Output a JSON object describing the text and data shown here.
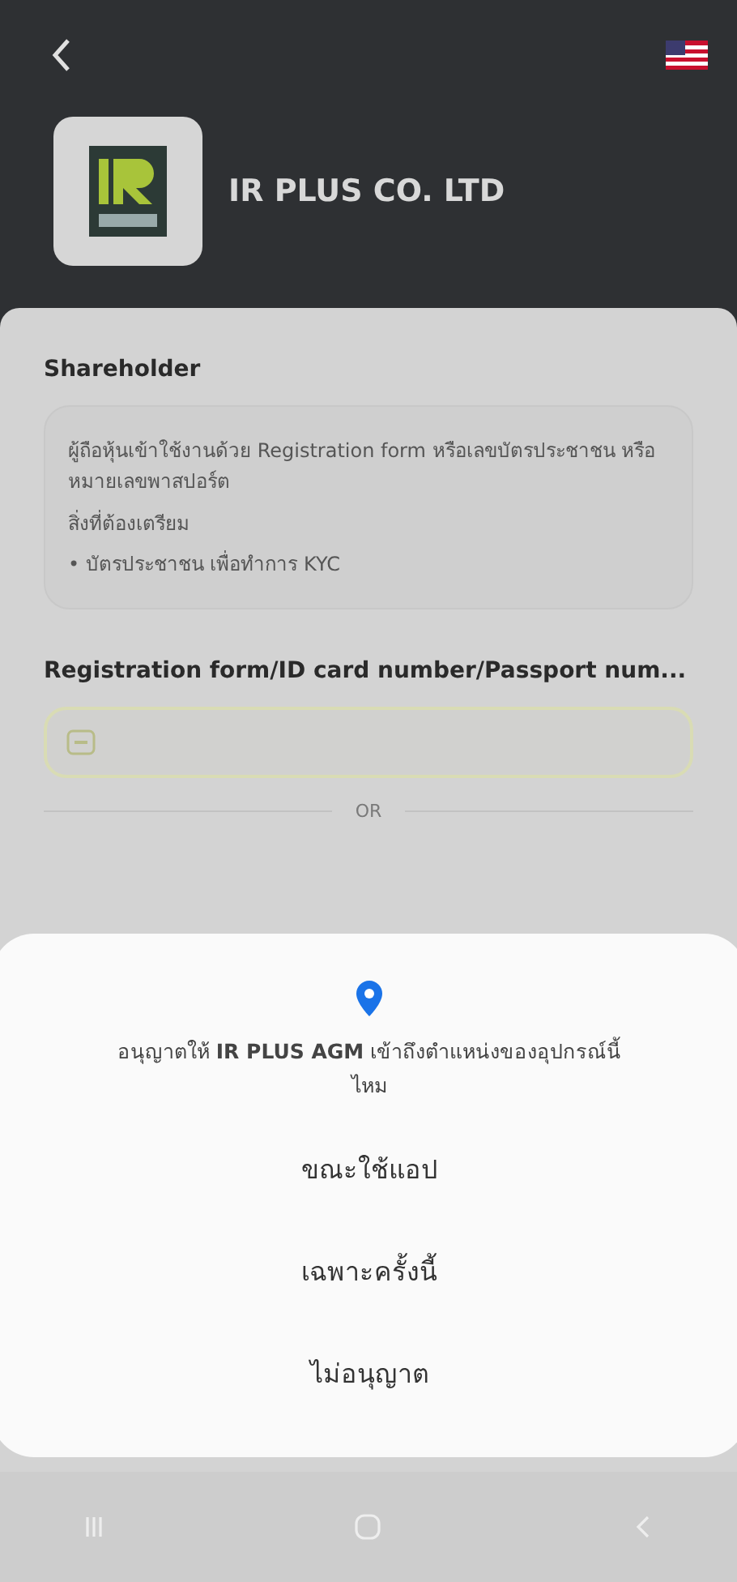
{
  "header": {
    "company_name": "IR PLUS CO. LTD"
  },
  "section_title": "Shareholder",
  "info": {
    "description": "ผู้ถือหุ้นเข้าใช้งานด้วย Registration form หรือเลขบัตรประชาชน หรือหมายเลขพาสปอร์ต",
    "prepare_title": "สิ่งที่ต้องเตรียม",
    "prepare_items": [
      "• บัตรประชาชน เพื่อทำการ KYC"
    ]
  },
  "field": {
    "label": "Registration form/ID card number/Passport num..."
  },
  "divider_text": "OR",
  "dialog": {
    "message": "อนุญาตให้ **IR PLUS AGM** เข้าถึงตำแหน่งของอุปกรณ์นี้ไหม",
    "options": [
      "ขณะใช้แอป",
      "เฉพาะครั้งนี้",
      "ไม่อนุญาต"
    ]
  }
}
